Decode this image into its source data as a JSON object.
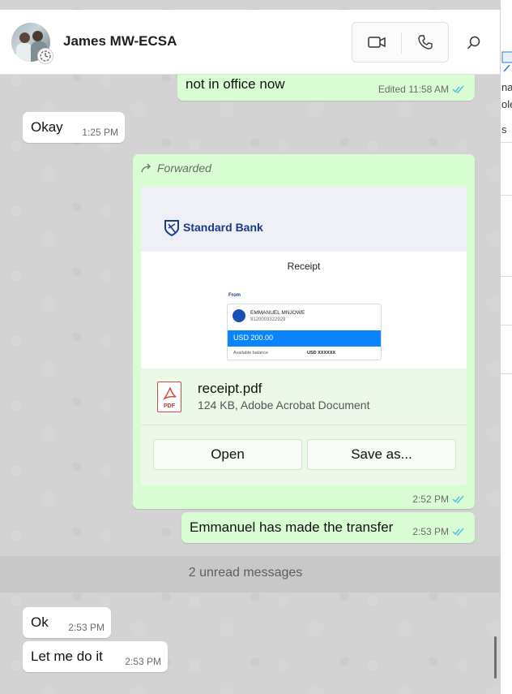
{
  "header": {
    "contact_name": "James MW-ECSA"
  },
  "messages": {
    "m1": {
      "text": "not in office now",
      "time": "Edited 11:58 AM"
    },
    "m2": {
      "text": "Okay",
      "time": "1:25 PM"
    },
    "forward": {
      "forwarded_label": "Forwarded",
      "preview": {
        "bank_name": "Standard Bank",
        "receipt_title": "Receipt",
        "from_label": "From",
        "payer_name": "EMMANUEL MNJOWE",
        "account_number": "9120003322929",
        "amount": "USD 200.00",
        "available_label": "Available balance",
        "available_value": "USD XXXXXX"
      },
      "file_name": "receipt.pdf",
      "file_info": "124 KB, Adobe Acrobat Document",
      "pdf_label": "PDF",
      "open_label": "Open",
      "save_label": "Save as...",
      "time": "2:52 PM"
    },
    "m4": {
      "text": "Emmanuel has made the transfer",
      "time": "2:53 PM"
    },
    "unread": "2 unread messages",
    "m5": {
      "text": "Ok",
      "time": "2:53 PM"
    },
    "m6": {
      "text": "Let me do it",
      "time": "2:53 PM"
    }
  },
  "right_strip": {
    "t1": "na",
    "t2": "ole",
    "t3": "s"
  },
  "colors": {
    "outgoing_bubble": "#d9fdd3",
    "incoming_bubble": "#ffffff",
    "read_tick": "#53bdeb",
    "bank_blue": "#1a3a8a"
  }
}
